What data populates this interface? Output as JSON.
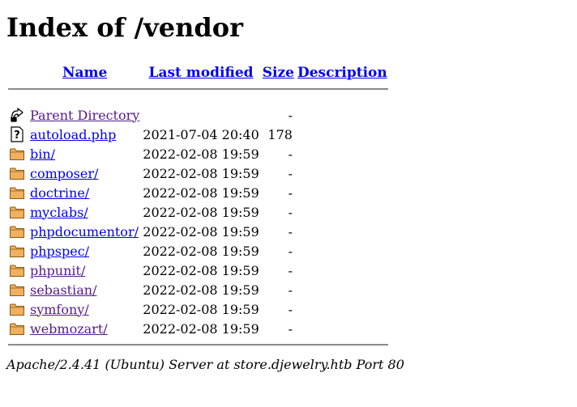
{
  "page": {
    "title": "Index of /vendor"
  },
  "table": {
    "headers": {
      "name": "Name",
      "last_modified": "Last modified",
      "size": "Size",
      "description": "Description"
    },
    "parent": {
      "label": "Parent Directory",
      "size": "-",
      "icon": "back-arrow-icon"
    },
    "rows": [
      {
        "name": "autoload.php",
        "date": "2021-07-04 20:40",
        "size": "178",
        "icon": "unknown-file-icon",
        "visited": false
      },
      {
        "name": "bin/",
        "date": "2022-02-08 19:59",
        "size": "-",
        "icon": "folder-icon",
        "visited": false
      },
      {
        "name": "composer/",
        "date": "2022-02-08 19:59",
        "size": "-",
        "icon": "folder-icon",
        "visited": false
      },
      {
        "name": "doctrine/",
        "date": "2022-02-08 19:59",
        "size": "-",
        "icon": "folder-icon",
        "visited": false
      },
      {
        "name": "myclabs/",
        "date": "2022-02-08 19:59",
        "size": "-",
        "icon": "folder-icon",
        "visited": false
      },
      {
        "name": "phpdocumentor/",
        "date": "2022-02-08 19:59",
        "size": "-",
        "icon": "folder-icon",
        "visited": false
      },
      {
        "name": "phpspec/",
        "date": "2022-02-08 19:59",
        "size": "-",
        "icon": "folder-icon",
        "visited": false
      },
      {
        "name": "phpunit/",
        "date": "2022-02-08 19:59",
        "size": "-",
        "icon": "folder-icon",
        "visited": true
      },
      {
        "name": "sebastian/",
        "date": "2022-02-08 19:59",
        "size": "-",
        "icon": "folder-icon",
        "visited": true
      },
      {
        "name": "symfony/",
        "date": "2022-02-08 19:59",
        "size": "-",
        "icon": "folder-icon",
        "visited": true
      },
      {
        "name": "webmozart/",
        "date": "2022-02-08 19:59",
        "size": "-",
        "icon": "folder-icon",
        "visited": true
      }
    ]
  },
  "footer": {
    "address": "Apache/2.4.41 (Ubuntu) Server at store.djewelry.htb Port 80"
  },
  "colors": {
    "link": "#0000ee",
    "visited_link": "#551a8b",
    "rule": "#8a8a8a",
    "folder_fill": "#f0b060",
    "folder_stroke": "#8a5a10"
  }
}
